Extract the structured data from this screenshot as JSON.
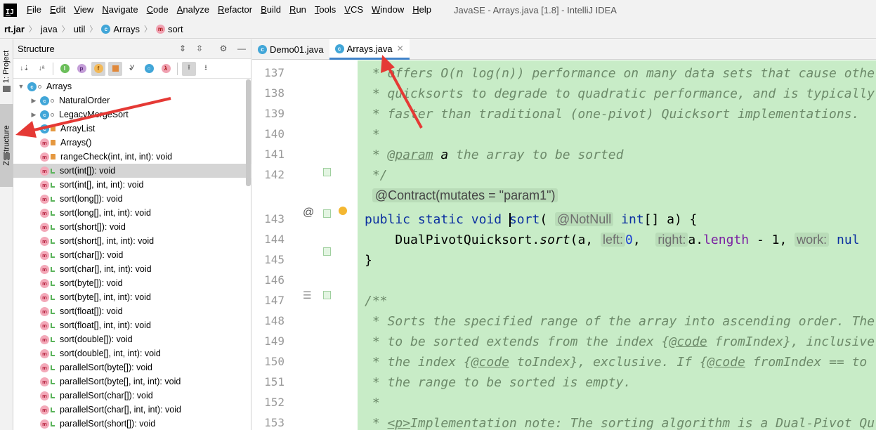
{
  "window": {
    "title": "JavaSE - Arrays.java [1.8] - IntelliJ IDEA",
    "logo": "IJ"
  },
  "menu": [
    "File",
    "Edit",
    "View",
    "Navigate",
    "Code",
    "Analyze",
    "Refactor",
    "Build",
    "Run",
    "Tools",
    "VCS",
    "Window",
    "Help"
  ],
  "breadcrumb": {
    "jar": "rt.jar",
    "pkg1": "java",
    "pkg2": "util",
    "cls": "Arrays",
    "method": "sort",
    "class_icon": "c",
    "method_icon": "m"
  },
  "toolstrip": {
    "project": "1: Project",
    "structure": "Z: Structure"
  },
  "structure": {
    "title": "Structure",
    "root": "Arrays",
    "items": [
      {
        "label": "NaturalOrder",
        "kind": "class",
        "vis": "pkg",
        "expandable": true
      },
      {
        "label": "LegacyMergeSort",
        "kind": "class",
        "vis": "pkg",
        "expandable": true
      },
      {
        "label": "ArrayList",
        "kind": "class",
        "vis": "priv",
        "expandable": true
      },
      {
        "label": "Arrays()",
        "kind": "method",
        "vis": "priv",
        "expandable": false
      },
      {
        "label": "rangeCheck(int, int, int): void",
        "kind": "method",
        "vis": "priv",
        "expandable": false
      },
      {
        "label": "sort(int[]): void",
        "kind": "method",
        "vis": "pub",
        "expandable": false,
        "selected": true
      },
      {
        "label": "sort(int[], int, int): void",
        "kind": "method",
        "vis": "pub",
        "expandable": false
      },
      {
        "label": "sort(long[]): void",
        "kind": "method",
        "vis": "pub",
        "expandable": false
      },
      {
        "label": "sort(long[], int, int): void",
        "kind": "method",
        "vis": "pub",
        "expandable": false
      },
      {
        "label": "sort(short[]): void",
        "kind": "method",
        "vis": "pub",
        "expandable": false
      },
      {
        "label": "sort(short[], int, int): void",
        "kind": "method",
        "vis": "pub",
        "expandable": false
      },
      {
        "label": "sort(char[]): void",
        "kind": "method",
        "vis": "pub",
        "expandable": false
      },
      {
        "label": "sort(char[], int, int): void",
        "kind": "method",
        "vis": "pub",
        "expandable": false
      },
      {
        "label": "sort(byte[]): void",
        "kind": "method",
        "vis": "pub",
        "expandable": false
      },
      {
        "label": "sort(byte[], int, int): void",
        "kind": "method",
        "vis": "pub",
        "expandable": false
      },
      {
        "label": "sort(float[]): void",
        "kind": "method",
        "vis": "pub",
        "expandable": false
      },
      {
        "label": "sort(float[], int, int): void",
        "kind": "method",
        "vis": "pub",
        "expandable": false
      },
      {
        "label": "sort(double[]): void",
        "kind": "method",
        "vis": "pub",
        "expandable": false
      },
      {
        "label": "sort(double[], int, int): void",
        "kind": "method",
        "vis": "pub",
        "expandable": false
      },
      {
        "label": "parallelSort(byte[]): void",
        "kind": "method",
        "vis": "pub",
        "expandable": false
      },
      {
        "label": "parallelSort(byte[], int, int): void",
        "kind": "method",
        "vis": "pub",
        "expandable": false
      },
      {
        "label": "parallelSort(char[]): void",
        "kind": "method",
        "vis": "pub",
        "expandable": false
      },
      {
        "label": "parallelSort(char[], int, int): void",
        "kind": "method",
        "vis": "pub",
        "expandable": false
      },
      {
        "label": "parallelSort(short[]): void",
        "kind": "method",
        "vis": "pub",
        "expandable": false
      }
    ],
    "toolbar_icons": [
      "sort-by-type-icon",
      "sort-alpha-icon",
      "show-inherited-icon",
      "show-properties-icon",
      "show-fields-icon",
      "show-non-public-icon",
      "show-lambdas-icon",
      "anonymous-classes-icon",
      "autoscroll-to-source-icon",
      "autoscroll-from-source-icon"
    ],
    "toolbar_glyphs": {
      "inherited": "I",
      "properties": "p",
      "fields": "f",
      "lambda": "λ"
    }
  },
  "tabs": [
    {
      "label": "Demo01.java",
      "active": false
    },
    {
      "label": "Arrays.java",
      "active": true
    }
  ],
  "editor": {
    "lines": [
      {
        "n": "137",
        "t": " * offers O(n log(n)) performance on many data sets that cause other"
      },
      {
        "n": "138",
        "t": " * quicksorts to degrade to quadratic performance, and is typically"
      },
      {
        "n": "139",
        "t": " * faster than traditional (one-pivot) Quicksort implementations."
      },
      {
        "n": "140",
        "t": " *"
      },
      {
        "n": "141",
        "t": " the array to be sorted"
      },
      {
        "n": "142",
        "t": " */"
      },
      {
        "n": "143",
        "t": ""
      },
      {
        "n": "144",
        "t": ""
      },
      {
        "n": "145",
        "t": "}"
      },
      {
        "n": "146",
        "t": ""
      },
      {
        "n": "147",
        "t": "/**"
      },
      {
        "n": "148",
        "t": " * Sorts the specified range of the array into ascending order. The"
      },
      {
        "n": "149",
        "t": " fromIndex}, inclusive"
      },
      {
        "n": "150",
        "t": " toIndex}, exclusive. If {"
      },
      {
        "n": "151",
        "t": " * the range to be sorted is empty."
      },
      {
        "n": "152",
        "t": " *"
      },
      {
        "n": "153",
        "t": "Implementation note: The sorting algorithm is a Dual-Pivot Qu"
      }
    ],
    "param_tag": "@param",
    "param_name": "a",
    "contract": "@Contract(mutates = \"param1\")",
    "kw_public": "public",
    "kw_static": "static",
    "kw_void": "void",
    "method_name": "sort",
    "not_null": "@NotNull",
    "kw_int": "int",
    "sig_rest": "[] a) {",
    "call_cls": "DualPivotQuicksort.",
    "call_fn": "sort",
    "call_a": "(a, ",
    "hint_left": "left:",
    "val_left": "0",
    "hint_right": "right:",
    "right_a": "a.",
    "right_len": "length",
    "right_rest": " - 1, ",
    "hint_work": "work:",
    "work_tail": "nul",
    "l149_pre": " * to be sorted extends from the index {",
    "l150_pre": " * the index {",
    "l150_tail": "fromIndex == to",
    "code_tag": "@code",
    "p_tag": "<p>",
    "l153_pre": " * ",
    "gutter_override": "@"
  },
  "colors": {
    "editor_bg": "#c8ecc7",
    "arrow": "#e53935",
    "accent": "#4083c9"
  }
}
